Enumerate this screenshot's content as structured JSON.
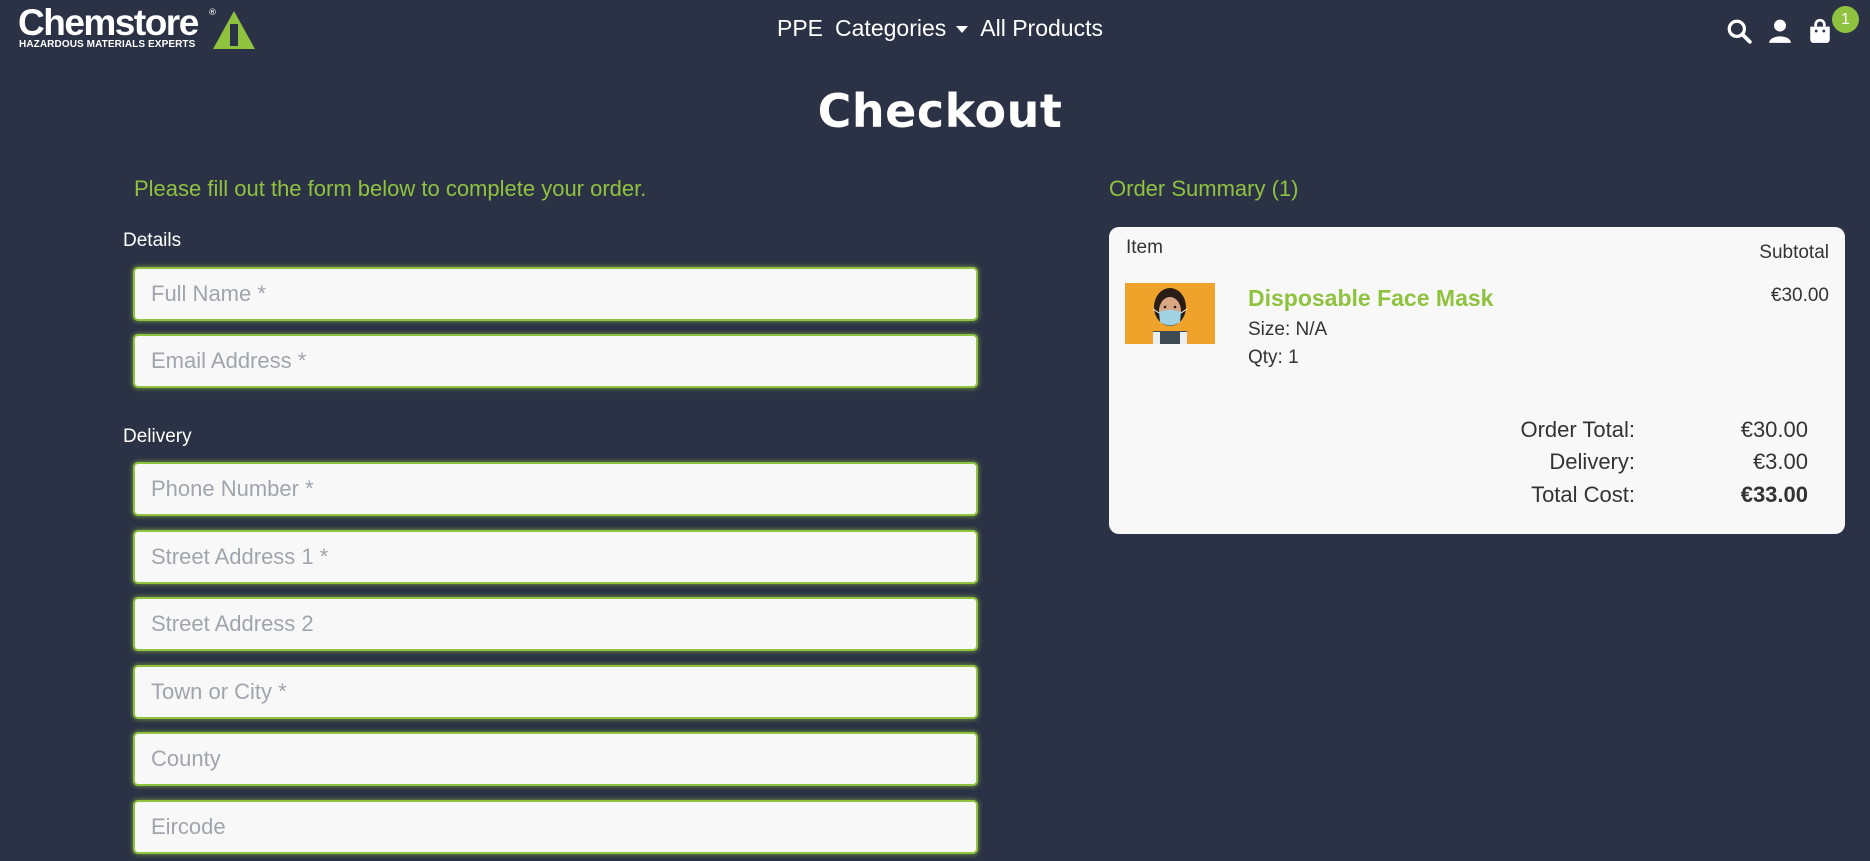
{
  "brand": {
    "name": "Chemstore",
    "registered": "®",
    "tagline": "HAZARDOUS MATERIALS EXPERTS",
    "accent_color": "#8fc23f",
    "background_color": "#2b3245"
  },
  "nav": {
    "ppe": "PPE",
    "categories": "Categories",
    "all_products": "All Products"
  },
  "header_icons": {
    "search": "search-icon",
    "account": "user-icon",
    "bag": "shopping-bag-icon",
    "bag_count": "1"
  },
  "page": {
    "title": "Checkout",
    "intro": "Please fill out the form below to complete your order."
  },
  "form": {
    "details_label": "Details",
    "delivery_label": "Delivery",
    "full_name": {
      "value": "",
      "placeholder": "Full Name *"
    },
    "email": {
      "value": "",
      "placeholder": "Email Address *"
    },
    "phone": {
      "value": "",
      "placeholder": "Phone Number *"
    },
    "street1": {
      "value": "",
      "placeholder": "Street Address 1 *"
    },
    "street2": {
      "value": "",
      "placeholder": "Street Address 2"
    },
    "town": {
      "value": "",
      "placeholder": "Town or City *"
    },
    "county": {
      "value": "",
      "placeholder": "County"
    },
    "eircode": {
      "value": "",
      "placeholder": "Eircode"
    }
  },
  "summary": {
    "title": "Order Summary (1)",
    "col_item": "Item",
    "col_subtotal": "Subtotal",
    "items": [
      {
        "name": "Disposable Face Mask",
        "size": "Size: N/A",
        "qty": "Qty: 1",
        "price": "€30.00"
      }
    ],
    "order_total_label": "Order Total:",
    "order_total": "€30.00",
    "delivery_label": "Delivery:",
    "delivery": "€3.00",
    "total_cost_label": "Total Cost:",
    "total_cost": "€33.00"
  }
}
